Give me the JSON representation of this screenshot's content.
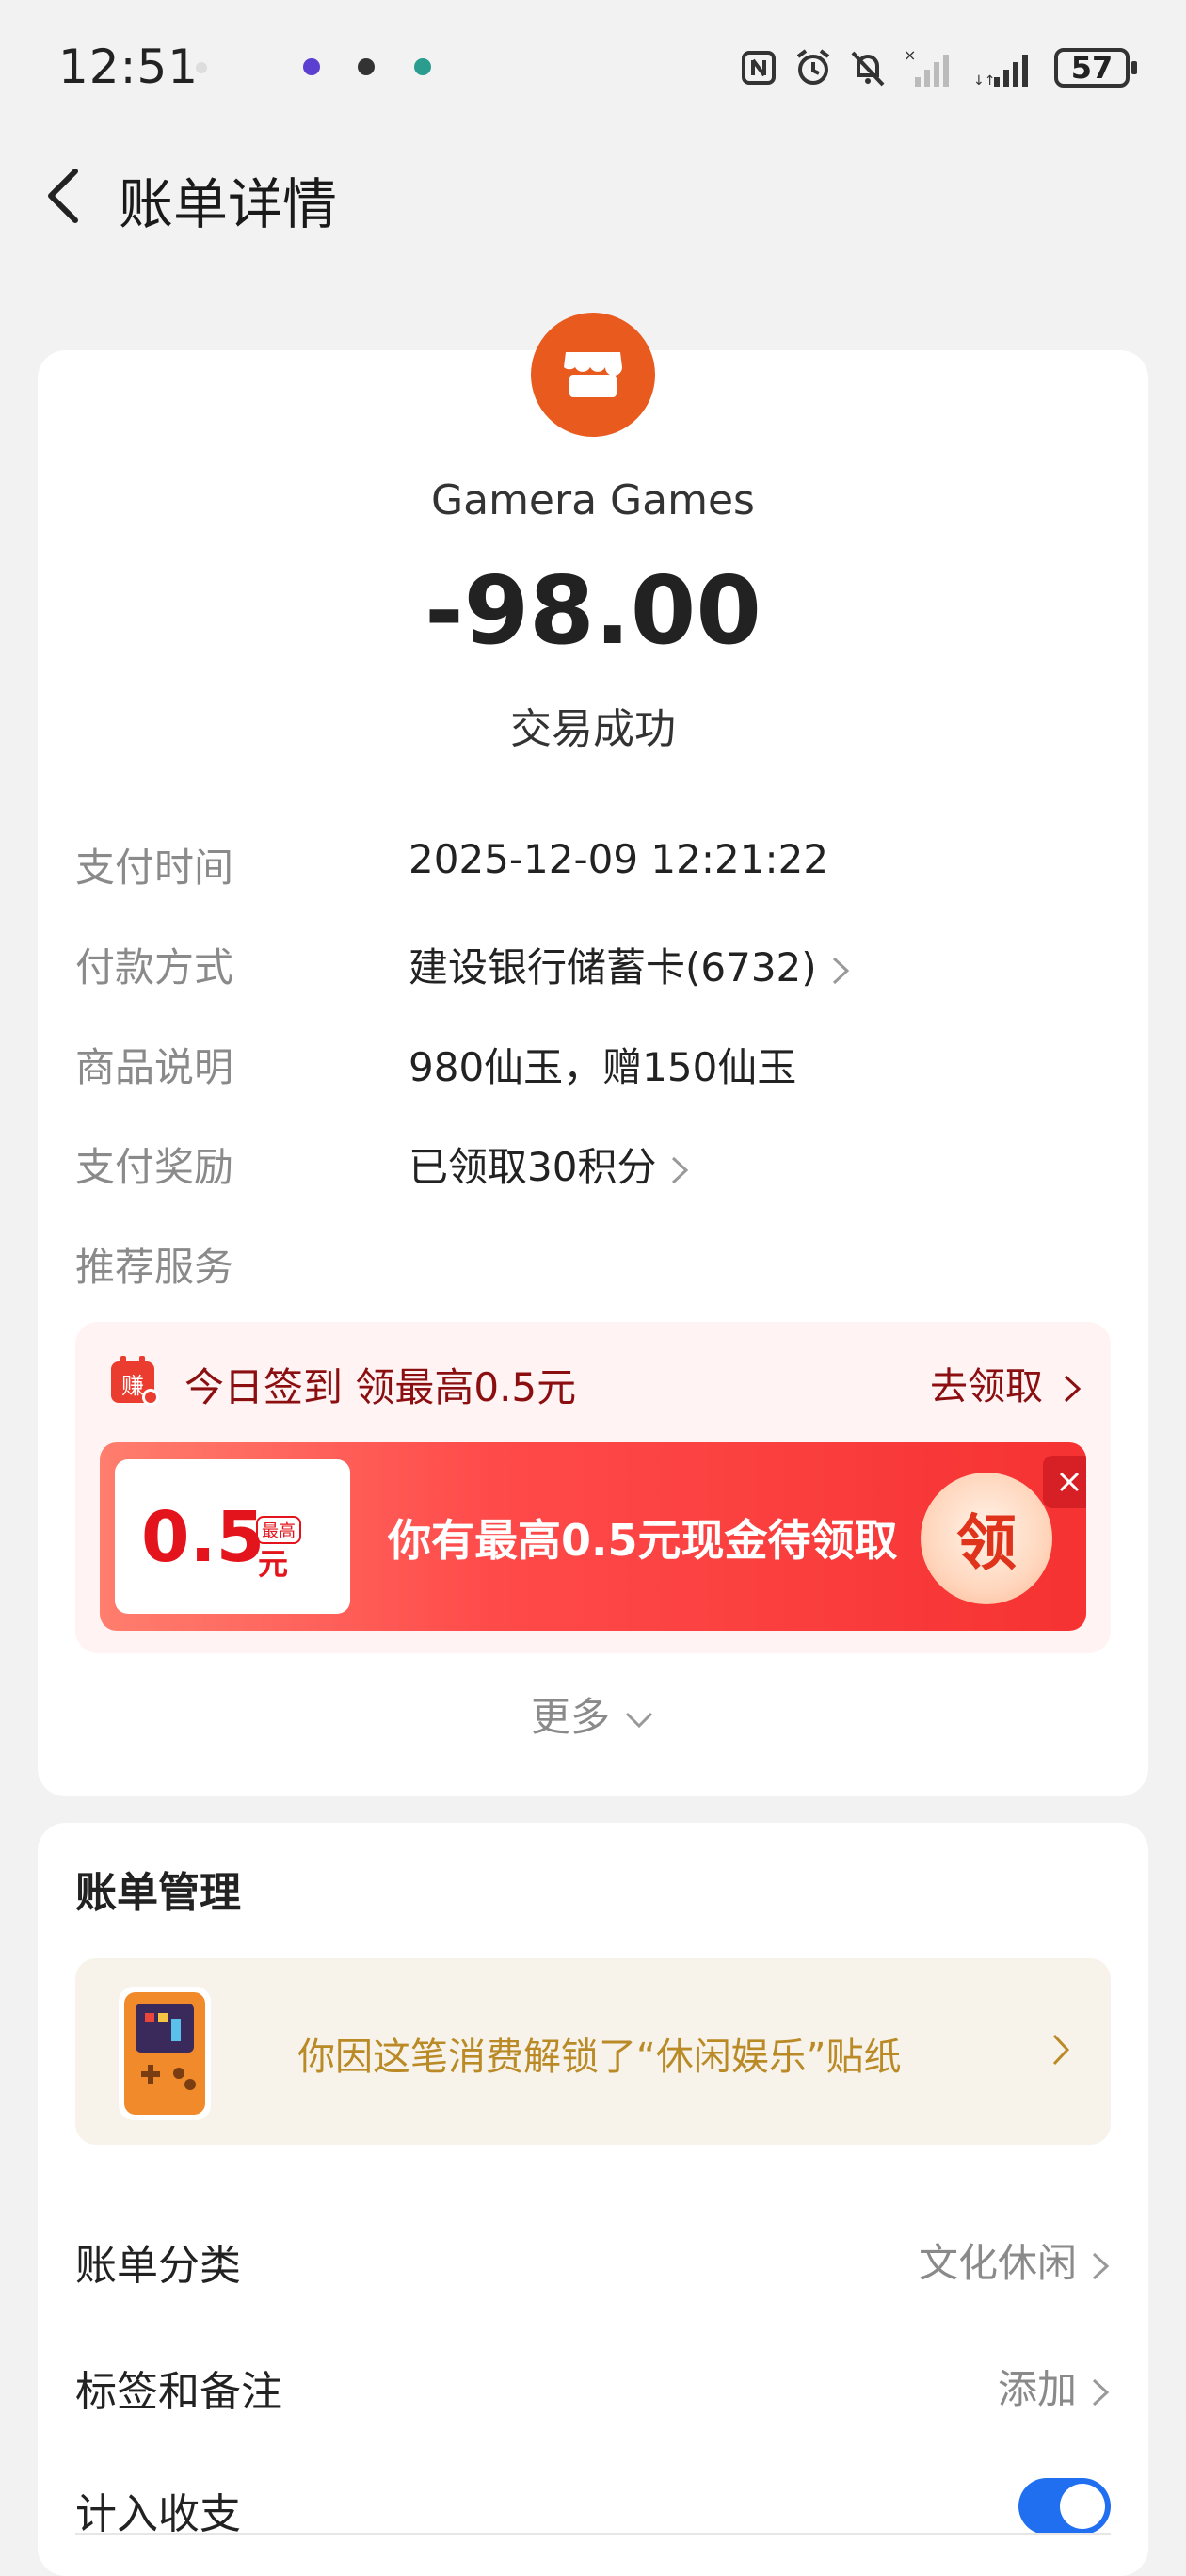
{
  "status_bar": {
    "time": "12:51",
    "battery": "57",
    "icons": [
      "nfc-icon",
      "alarm-icon",
      "mute-icon",
      "signal-x-icon",
      "signal-icon"
    ]
  },
  "header": {
    "title": "账单详情",
    "back_icon": "chevron-left-icon"
  },
  "transaction": {
    "merchant_icon": "store-icon",
    "merchant_color": "#e95a1f",
    "merchant_name": "Gamera Games",
    "amount": "-98.00",
    "status": "交易成功"
  },
  "details": [
    {
      "label": "支付时间",
      "value": "2025-12-09 12:21:22"
    },
    {
      "label": "付款方式",
      "value": "建设银行储蓄卡(6732)"
    },
    {
      "label": "商品说明",
      "value": "980仙玉，赠150仙玉"
    },
    {
      "label": "支付奖励",
      "value": "已领取30积分"
    },
    {
      "label": "推荐服务",
      "value": ""
    }
  ],
  "promo": {
    "title": "今日签到 领最高0.5元",
    "link": "去领取",
    "coupon_amount": "0.5",
    "coupon_unit": "元",
    "coupon_tag": "最高",
    "coupon_text": "你有最高0.5元现金待领取",
    "claim_label": "领",
    "calendar_icon_text": "赚"
  },
  "more_label": "更多",
  "management": {
    "title": "账单管理",
    "sticker_text": "你因这笔消费解锁了“休闲娱乐”贴纸",
    "rows": [
      {
        "label": "账单分类",
        "value": "文化休闲"
      },
      {
        "label": "标签和备注",
        "value": "添加"
      },
      {
        "label": "计入收支",
        "value": ""
      }
    ],
    "include_toggle_on": true,
    "accent_color": "#1f6ff0"
  }
}
